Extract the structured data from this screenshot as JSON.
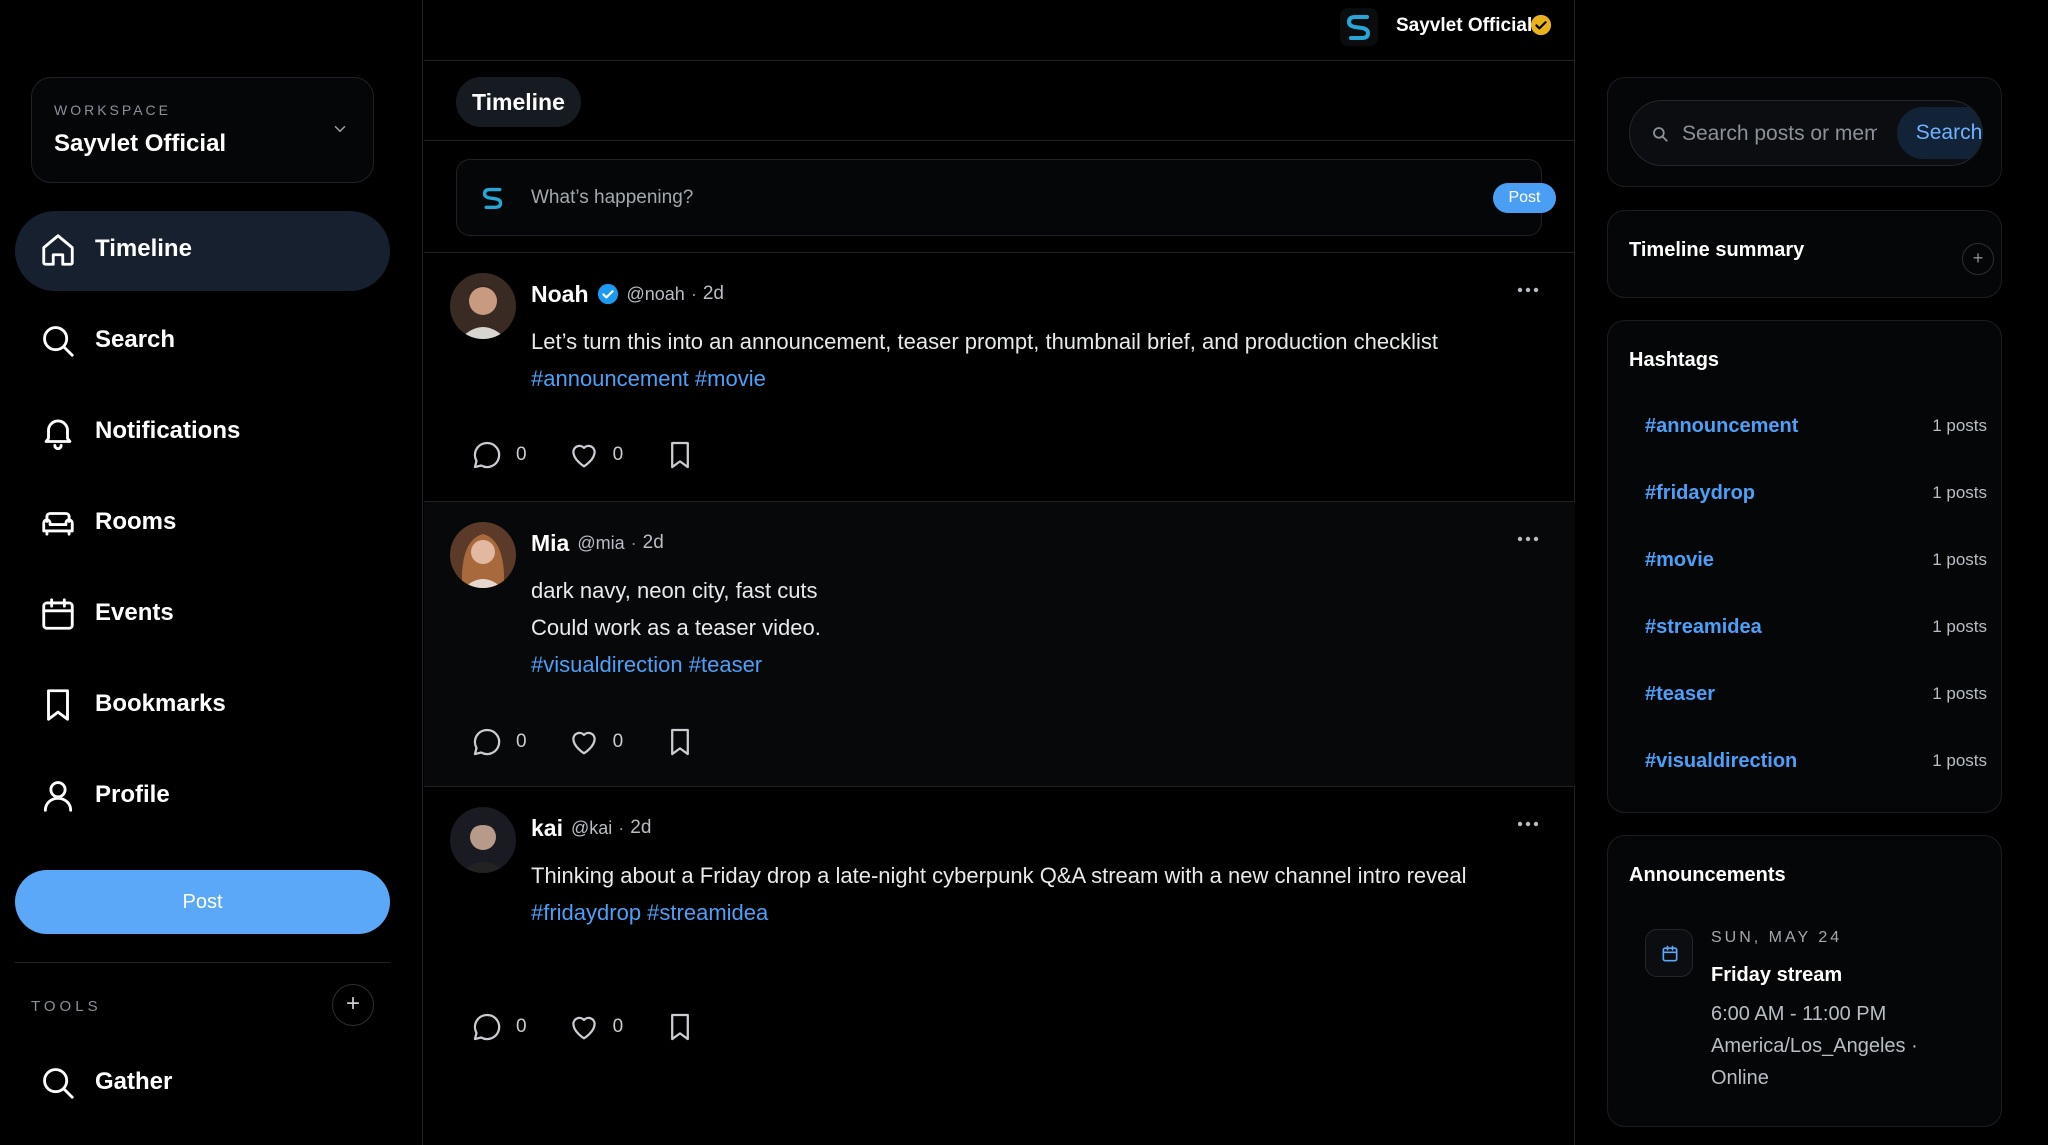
{
  "workspace": {
    "label": "WORKSPACE",
    "name": "Sayvlet Official"
  },
  "nav": {
    "items": [
      {
        "label": "Timeline",
        "icon": "home-icon"
      },
      {
        "label": "Search",
        "icon": "search-icon"
      },
      {
        "label": "Notifications",
        "icon": "bell-icon"
      },
      {
        "label": "Rooms",
        "icon": "sofa-icon"
      },
      {
        "label": "Events",
        "icon": "calendar-icon"
      },
      {
        "label": "Bookmarks",
        "icon": "bookmark-icon"
      },
      {
        "label": "Profile",
        "icon": "user-icon"
      }
    ],
    "post_label": "Post"
  },
  "tools": {
    "label": "TOOLS",
    "add_label": "+",
    "items": [
      {
        "label": "Gather",
        "icon": "search-icon"
      }
    ]
  },
  "topbar": {
    "account_name": "Sayvlet Official"
  },
  "tabs": [
    {
      "label": "Timeline"
    }
  ],
  "composer": {
    "placeholder": "What’s happening?",
    "post_label": "Post"
  },
  "posts": [
    {
      "name": "Noah",
      "handle": "@noah",
      "dot": "·",
      "time": "2d",
      "lines": [
        "Let’s turn this into an announcement, teaser prompt, thumbnail brief, and production checklist"
      ],
      "tags": "#announcement #movie",
      "comments": "0",
      "likes": "0"
    },
    {
      "name": "Mia",
      "handle": "@mia",
      "dot": "·",
      "time": "2d",
      "lines": [
        "dark navy, neon city, fast cuts",
        "Could work as a teaser video."
      ],
      "tags": "#visualdirection #teaser",
      "comments": "0",
      "likes": "0"
    },
    {
      "name": "kai",
      "handle": "@kai",
      "dot": "·",
      "time": "2d",
      "lines": [
        "Thinking about a Friday drop a late-night cyberpunk Q&A stream with a new channel intro reveal"
      ],
      "tags": "#fridaydrop #streamidea",
      "comments": "0",
      "likes": "0"
    }
  ],
  "search": {
    "placeholder": "Search posts or members",
    "button_label": "Search"
  },
  "summary": {
    "title": "Timeline summary",
    "add_label": "+"
  },
  "hashtags": {
    "title": "Hashtags",
    "items": [
      {
        "tag": "#announcement",
        "count": "1 posts"
      },
      {
        "tag": "#fridaydrop",
        "count": "1 posts"
      },
      {
        "tag": "#movie",
        "count": "1 posts"
      },
      {
        "tag": "#streamidea",
        "count": "1 posts"
      },
      {
        "tag": "#teaser",
        "count": "1 posts"
      },
      {
        "tag": "#visualdirection",
        "count": "1 posts"
      }
    ]
  },
  "announcements": {
    "title": "Announcements",
    "items": [
      {
        "date": "SUN, MAY 24",
        "title": "Friday stream",
        "time": "6:00 AM - 11:00 PM",
        "location": "America/Los_Angeles · Online"
      }
    ]
  },
  "colors": {
    "accent": "#4da0f7",
    "post_button": "#5aa8f7",
    "verified_blue": "#1d9bf0",
    "verified_gold": "#e8b21c",
    "background": "#000000"
  }
}
